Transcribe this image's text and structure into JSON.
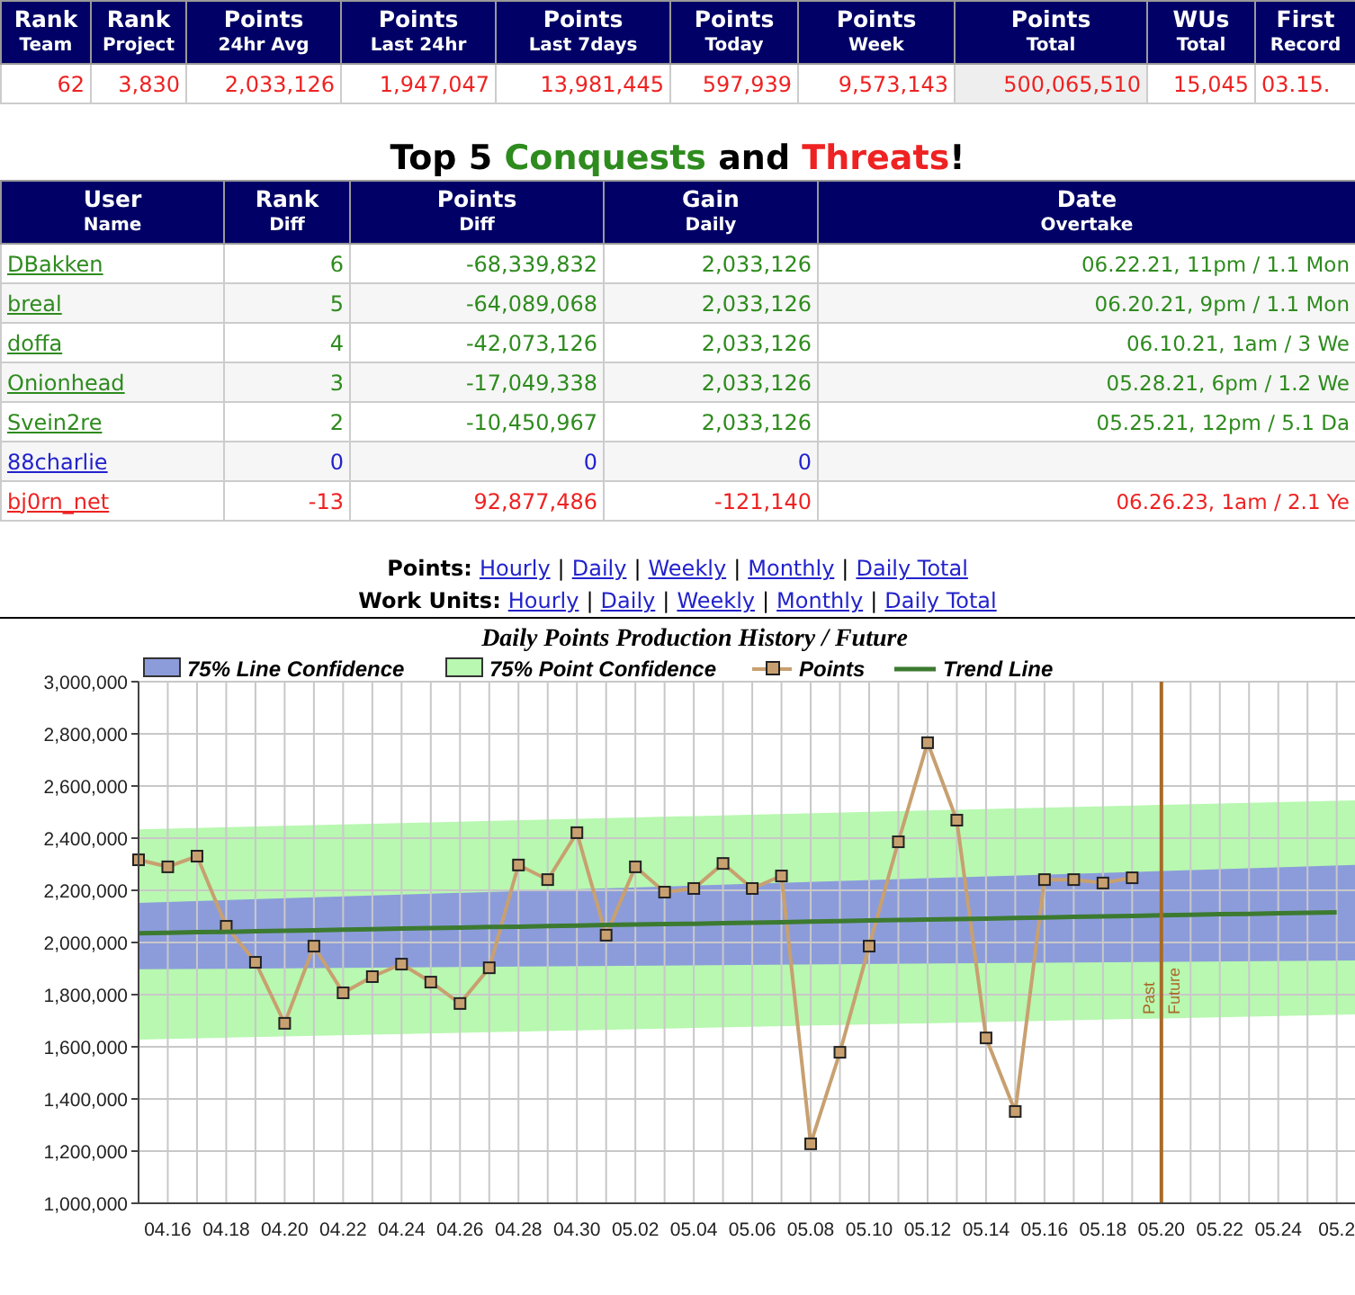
{
  "summary_table": {
    "columns": [
      {
        "title": "Rank",
        "sub": "Team",
        "selected": false
      },
      {
        "title": "Rank",
        "sub": "Project",
        "selected": false
      },
      {
        "title": "Points",
        "sub": "24hr Avg",
        "selected": false
      },
      {
        "title": "Points",
        "sub": "Last 24hr",
        "selected": false
      },
      {
        "title": "Points",
        "sub": "Last 7days",
        "selected": false
      },
      {
        "title": "Points",
        "sub": "Today",
        "selected": false
      },
      {
        "title": "Points",
        "sub": "Week",
        "selected": false
      },
      {
        "title": "Points",
        "sub": "Total",
        "selected": true
      },
      {
        "title": "WUs",
        "sub": "Total",
        "selected": false
      },
      {
        "title": "First",
        "sub": "Record",
        "selected": false
      }
    ],
    "row": [
      "62",
      "3,830",
      "2,033,126",
      "1,947,047",
      "13,981,445",
      "597,939",
      "9,573,143",
      "500,065,510",
      "15,045",
      "03.15."
    ]
  },
  "section_title": [
    {
      "text": "Top 5 ",
      "kind": "plain"
    },
    {
      "text": "Conquests",
      "kind": "conquest"
    },
    {
      "text": " and ",
      "kind": "plain"
    },
    {
      "text": "Threats",
      "kind": "threat"
    },
    {
      "text": "!",
      "kind": "plain"
    }
  ],
  "rivals_table": {
    "columns": [
      {
        "title": "User",
        "sub": "Name"
      },
      {
        "title": "Rank",
        "sub": "Diff"
      },
      {
        "title": "Points",
        "sub": "Diff"
      },
      {
        "title": "Gain",
        "sub": "Daily"
      },
      {
        "title": "Date",
        "sub": "Overtake"
      }
    ],
    "rows": [
      {
        "kind": "conquest",
        "user": "DBakken",
        "rank": "6",
        "points": "-68,339,832",
        "gain": "2,033,126",
        "date": "06.22.21, 11pm / 1.1 Mon"
      },
      {
        "kind": "conquest",
        "user": "breal",
        "rank": "5",
        "points": "-64,089,068",
        "gain": "2,033,126",
        "date": "06.20.21, 9pm / 1.1 Mon"
      },
      {
        "kind": "conquest",
        "user": "doffa",
        "rank": "4",
        "points": "-42,073,126",
        "gain": "2,033,126",
        "date": "06.10.21, 1am / 3 We"
      },
      {
        "kind": "conquest",
        "user": "Onionhead",
        "rank": "3",
        "points": "-17,049,338",
        "gain": "2,033,126",
        "date": "05.28.21, 6pm / 1.2 We"
      },
      {
        "kind": "conquest",
        "user": "Svein2re",
        "rank": "2",
        "points": "-10,450,967",
        "gain": "2,033,126",
        "date": "05.25.21, 12pm / 5.1 Da"
      },
      {
        "kind": "self",
        "user": "88charlie",
        "rank": "0",
        "points": "0",
        "gain": "0"
      },
      {
        "kind": "threat",
        "user": "bj0rn_net",
        "rank": "-13",
        "points": "92,877,486",
        "gain": "-121,140",
        "date": "06.26.23, 1am / 2.1 Ye"
      }
    ]
  },
  "link_rows": [
    {
      "label": "Points:",
      "links": [
        "Hourly",
        "Daily",
        "Weekly",
        "Monthly",
        "Daily Total"
      ],
      "separators": [
        "|",
        "|",
        "|",
        "|"
      ]
    },
    {
      "label": "Work Units:",
      "links": [
        "Hourly",
        "Daily",
        "Weekly",
        "Monthly",
        "Daily Total"
      ],
      "separators": [
        "|",
        "|",
        "|",
        "|"
      ]
    }
  ],
  "chart": {
    "chart_data": {
      "type": "line",
      "title": "Daily Points Production History / Future",
      "categories": [
        null,
        "04.16",
        null,
        "04.18",
        null,
        "04.20",
        null,
        "04.22",
        null,
        "04.24",
        null,
        "04.26",
        null,
        "04.28",
        null,
        "04.30",
        null,
        "05.02",
        null,
        "05.04",
        null,
        "05.06",
        null,
        "05.08",
        null,
        "05.10",
        null,
        "05.12",
        null,
        "05.14",
        null,
        "05.16",
        null,
        "05.18",
        null,
        "05.20",
        null,
        "05.22",
        null,
        "05.24",
        null,
        "05.2"
      ],
      "series": [
        {
          "name": "Points",
          "color": "#c8a070",
          "marker": "square",
          "values": [
            2317000,
            2290000,
            2331000,
            2062000,
            1924000,
            1690000,
            1986000,
            1807000,
            1869000,
            1917000,
            1848000,
            1766000,
            1903000,
            2297000,
            2241000,
            2421000,
            2028000,
            2290000,
            2193000,
            2207000,
            2303000,
            2207000,
            2255000,
            1228000,
            1579000,
            1986000,
            2386000,
            2766000,
            2469000,
            1634000,
            1352000,
            2241000,
            2241000,
            2228000,
            2248000,
            null,
            null,
            null,
            null,
            null,
            null,
            null
          ]
        },
        {
          "name": "Trend Line",
          "color": "#3c7a30",
          "values": [
            2035000,
            2037000,
            2039000,
            2041000,
            2043000,
            2045000,
            2047000,
            2049000,
            2051000,
            2053000,
            2055000,
            2057000,
            2059000,
            2061000,
            2063000,
            2065000,
            2067000,
            2069000,
            2070000,
            2072000,
            2074000,
            2076000,
            2078000,
            2080000,
            2082000,
            2084000,
            2086000,
            2088000,
            2090000,
            2092000,
            2094000,
            2096000,
            2098000,
            2100000,
            2102000,
            2104000,
            2106000,
            2108000,
            2110000,
            2112000,
            2114000,
            2116000
          ]
        }
      ],
      "ylim": [
        1000000,
        3000000
      ],
      "grid": true,
      "legend": "top",
      "ref_lines": [
        {
          "axis": "x",
          "value": "05.20",
          "color": "#a86a28"
        }
      ],
      "annotations": [
        "Past",
        "Future"
      ],
      "yticks": [
        {
          "value": 1000000,
          "label": "1,000,000"
        },
        {
          "value": 1200000,
          "label": "1,200,000"
        },
        {
          "value": 1400000,
          "label": "1,400,000"
        },
        {
          "value": 1600000,
          "label": "1,600,000"
        },
        {
          "value": 1800000,
          "label": "1,800,000"
        },
        {
          "value": 2000000,
          "label": "2,000,000"
        },
        {
          "value": 2200000,
          "label": "2,200,000"
        },
        {
          "value": 2400000,
          "label": "2,400,000"
        },
        {
          "value": 2600000,
          "label": "2,600,000"
        },
        {
          "value": 2800000,
          "label": "2,800,000"
        },
        {
          "value": 3000000,
          "label": "3,000,000"
        }
      ]
    },
    "band_legend": [
      {
        "label": "75% Line Confidence",
        "color": "#8c9cdb"
      },
      {
        "label": "75% Point Confidence",
        "color": "#b8f8b0"
      }
    ]
  }
}
